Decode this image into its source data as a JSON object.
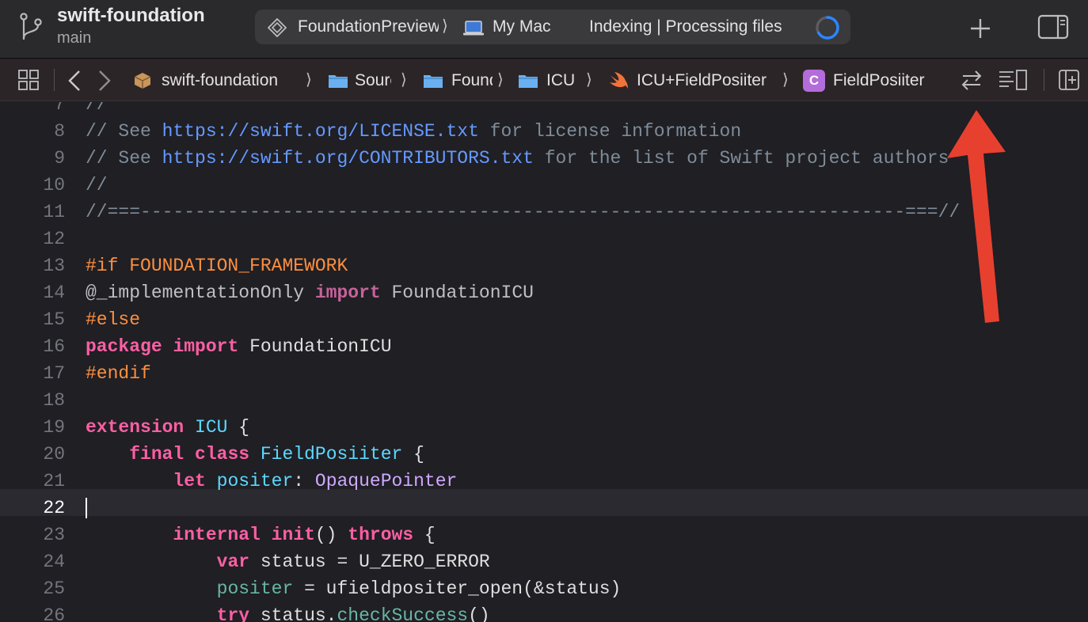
{
  "toolbar": {
    "project_name": "swift-foundation",
    "branch": "main",
    "scheme": "FoundationPreview",
    "destination": "My Mac",
    "status": "Indexing | Processing files"
  },
  "jump_bar": {
    "items": [
      {
        "label": "swift-foundation",
        "icon": "package-icon"
      },
      {
        "label": "Sources",
        "icon": "folder-icon"
      },
      {
        "label": "Foundation",
        "icon": "folder-icon"
      },
      {
        "label": "ICU",
        "icon": "folder-icon"
      },
      {
        "label": "ICU+FieldPosiiter",
        "icon": "swift-file-icon"
      },
      {
        "label": "FieldPosiiter",
        "icon": "class-icon",
        "badge": "C"
      }
    ]
  },
  "editor": {
    "current_line": 22,
    "lines": [
      {
        "n": "7",
        "tokens": [
          {
            "t": "//",
            "c": "com"
          }
        ]
      },
      {
        "n": "8",
        "tokens": [
          {
            "t": "// See ",
            "c": "com"
          },
          {
            "t": "https://swift.org/LICENSE.txt",
            "c": "url"
          },
          {
            "t": " for license information",
            "c": "com"
          }
        ]
      },
      {
        "n": "9",
        "tokens": [
          {
            "t": "// See ",
            "c": "com"
          },
          {
            "t": "https://swift.org/CONTRIBUTORS.txt",
            "c": "url"
          },
          {
            "t": " for the list of Swift project authors",
            "c": "com"
          }
        ]
      },
      {
        "n": "10",
        "tokens": [
          {
            "t": "//",
            "c": "com"
          }
        ]
      },
      {
        "n": "11",
        "tokens": [
          {
            "t": "//===----------------------------------------------------------------------===//",
            "c": "com"
          }
        ]
      },
      {
        "n": "12",
        "tokens": []
      },
      {
        "n": "13",
        "tokens": [
          {
            "t": "#if FOUNDATION_FRAMEWORK",
            "c": "pre"
          }
        ]
      },
      {
        "n": "14",
        "tokens": [
          {
            "t": "@_implementationOnly ",
            "c": "attr"
          },
          {
            "t": "import",
            "c": "kwd"
          },
          {
            "t": " FoundationICU",
            "c": "attr"
          }
        ]
      },
      {
        "n": "15",
        "tokens": [
          {
            "t": "#else",
            "c": "pre"
          }
        ]
      },
      {
        "n": "16",
        "tokens": [
          {
            "t": "package",
            "c": "kw"
          },
          {
            "t": " ",
            "c": "pln"
          },
          {
            "t": "import",
            "c": "kw"
          },
          {
            "t": " FoundationICU",
            "c": "pln"
          }
        ]
      },
      {
        "n": "17",
        "tokens": [
          {
            "t": "#endif",
            "c": "pre"
          }
        ]
      },
      {
        "n": "18",
        "tokens": []
      },
      {
        "n": "19",
        "tokens": [
          {
            "t": "extension",
            "c": "kw"
          },
          {
            "t": " ",
            "c": "pln"
          },
          {
            "t": "ICU",
            "c": "type"
          },
          {
            "t": " {",
            "c": "pln"
          }
        ]
      },
      {
        "n": "20",
        "tokens": [
          {
            "t": "    ",
            "c": "pln"
          },
          {
            "t": "final",
            "c": "kw"
          },
          {
            "t": " ",
            "c": "pln"
          },
          {
            "t": "class",
            "c": "kw"
          },
          {
            "t": " ",
            "c": "pln"
          },
          {
            "t": "FieldPosiiter",
            "c": "type"
          },
          {
            "t": " {",
            "c": "pln"
          }
        ]
      },
      {
        "n": "21",
        "tokens": [
          {
            "t": "        ",
            "c": "pln"
          },
          {
            "t": "let",
            "c": "kw"
          },
          {
            "t": " ",
            "c": "pln"
          },
          {
            "t": "positer",
            "c": "type"
          },
          {
            "t": ": ",
            "c": "pln"
          },
          {
            "t": "OpaquePointer",
            "c": "ptype"
          }
        ]
      },
      {
        "n": "22",
        "tokens": []
      },
      {
        "n": "23",
        "tokens": [
          {
            "t": "        ",
            "c": "pln"
          },
          {
            "t": "internal",
            "c": "kw"
          },
          {
            "t": " ",
            "c": "pln"
          },
          {
            "t": "init",
            "c": "kw"
          },
          {
            "t": "() ",
            "c": "pln"
          },
          {
            "t": "throws",
            "c": "kw"
          },
          {
            "t": " {",
            "c": "pln"
          }
        ]
      },
      {
        "n": "24",
        "tokens": [
          {
            "t": "            ",
            "c": "pln"
          },
          {
            "t": "var",
            "c": "kw"
          },
          {
            "t": " status = U_ZERO_ERROR",
            "c": "pln"
          }
        ]
      },
      {
        "n": "25",
        "tokens": [
          {
            "t": "            ",
            "c": "pln"
          },
          {
            "t": "positer",
            "c": "prop"
          },
          {
            "t": " = ufieldpositer_open(&status)",
            "c": "pln"
          }
        ]
      },
      {
        "n": "26",
        "tokens": [
          {
            "t": "            ",
            "c": "pln"
          },
          {
            "t": "try",
            "c": "kw"
          },
          {
            "t": " status.",
            "c": "pln"
          },
          {
            "t": "checkSuccess",
            "c": "fn"
          },
          {
            "t": "()",
            "c": "pln"
          }
        ]
      }
    ]
  },
  "colors": {
    "annotation_arrow": "#e8402f",
    "spinner": "#2a86ff"
  }
}
